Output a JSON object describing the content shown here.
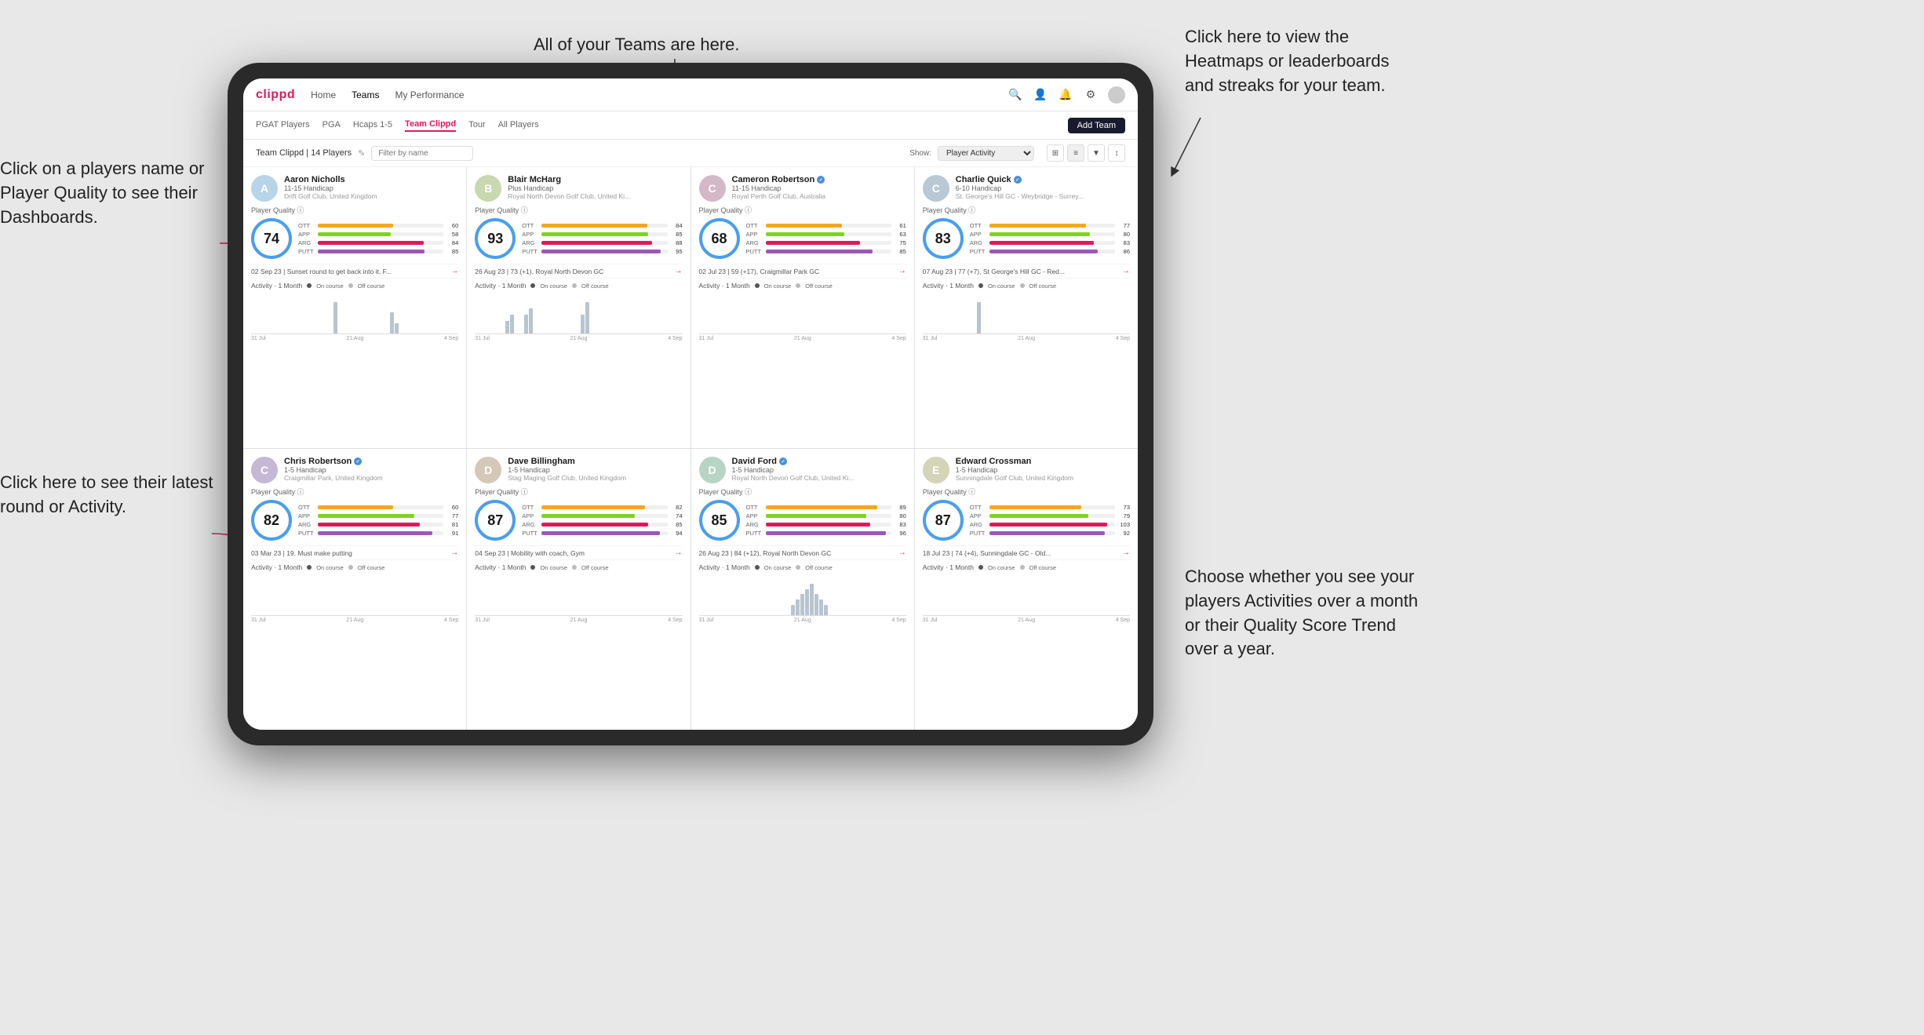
{
  "annotations": {
    "left_top": "Click on a players name\nor Player Quality to see\ntheir Dashboards.",
    "left_bottom": "Click here to see their latest\nround or Activity.",
    "top_center": "All of your Teams are here.",
    "top_right": "Click here to view the\nHeatmaps or leaderboards\nand streaks for your team.",
    "bottom_right": "Choose whether you see\nyour players Activities over\na month or their Quality\nScore Trend over a year."
  },
  "navbar": {
    "logo": "clippd",
    "links": [
      "Home",
      "Teams",
      "My Performance"
    ],
    "active_link": "Teams"
  },
  "subnav": {
    "links": [
      "PGAT Players",
      "PGA",
      "Hcaps 1-5",
      "Team Clippd",
      "Tour",
      "All Players"
    ],
    "active_link": "Team Clippd",
    "add_team_label": "Add Team"
  },
  "team_header": {
    "title": "Team Clippd | 14 Players",
    "filter_placeholder": "Filter by name",
    "show_label": "Show:",
    "show_value": "Player Activity"
  },
  "players": [
    {
      "name": "Aaron Nicholls",
      "handicap": "11-15 Handicap",
      "club": "Drift Golf Club, United Kingdom",
      "verified": false,
      "pq": 74,
      "bars": [
        {
          "label": "OTT",
          "value": 60,
          "color": "#f5a623",
          "max": 100
        },
        {
          "label": "APP",
          "value": 58,
          "color": "#7ed321",
          "max": 100
        },
        {
          "label": "ARG",
          "value": 84,
          "color": "#e0195a",
          "max": 100
        },
        {
          "label": "PUTT",
          "value": 85,
          "color": "#9b59b6",
          "max": 100
        }
      ],
      "latest_round": "02 Sep 23 | Sunset round to get back into it, F...",
      "activity_bars": [
        0,
        0,
        0,
        0,
        0,
        0,
        0,
        0,
        0,
        0,
        0,
        0,
        0,
        0,
        0,
        3,
        0,
        0,
        0,
        0,
        0,
        0,
        0,
        0,
        0,
        0,
        0,
        2,
        1
      ],
      "dates": [
        "31 Jul",
        "21 Aug",
        "4 Sep"
      ]
    },
    {
      "name": "Blair McHarg",
      "handicap": "Plus Handicap",
      "club": "Royal North Devon Golf Club, United Ki...",
      "verified": false,
      "pq": 93,
      "bars": [
        {
          "label": "OTT",
          "value": 84,
          "color": "#f5a623",
          "max": 100
        },
        {
          "label": "APP",
          "value": 85,
          "color": "#7ed321",
          "max": 100
        },
        {
          "label": "ARG",
          "value": 88,
          "color": "#e0195a",
          "max": 100
        },
        {
          "label": "PUTT",
          "value": 95,
          "color": "#9b59b6",
          "max": 100
        }
      ],
      "latest_round": "26 Aug 23 | 73 (+1), Royal North Devon GC",
      "activity_bars": [
        0,
        0,
        0,
        0,
        2,
        3,
        0,
        0,
        3,
        4,
        0,
        0,
        0,
        0,
        0,
        0,
        0,
        0,
        0,
        0,
        3,
        5,
        0,
        0,
        0,
        0,
        0,
        0,
        0
      ],
      "dates": [
        "31 Jul",
        "21 Aug",
        "4 Sep"
      ]
    },
    {
      "name": "Cameron Robertson",
      "handicap": "11-15 Handicap",
      "club": "Royal Perth Golf Club, Australia",
      "verified": true,
      "pq": 68,
      "bars": [
        {
          "label": "OTT",
          "value": 61,
          "color": "#f5a623",
          "max": 100
        },
        {
          "label": "APP",
          "value": 63,
          "color": "#7ed321",
          "max": 100
        },
        {
          "label": "ARG",
          "value": 75,
          "color": "#e0195a",
          "max": 100
        },
        {
          "label": "PUTT",
          "value": 85,
          "color": "#9b59b6",
          "max": 100
        }
      ],
      "latest_round": "02 Jul 23 | 59 (+17), Craigmillar Park GC",
      "activity_bars": [
        0,
        0,
        0,
        0,
        0,
        0,
        0,
        0,
        0,
        0,
        0,
        0,
        0,
        0,
        0,
        0,
        0,
        0,
        0,
        0,
        0,
        0,
        0,
        0,
        0,
        0,
        0,
        0,
        0
      ],
      "dates": [
        "31 Jul",
        "21 Aug",
        "4 Sep"
      ]
    },
    {
      "name": "Charlie Quick",
      "handicap": "6-10 Handicap",
      "club": "St. George's Hill GC - Weybridge - Surrey...",
      "verified": true,
      "pq": 83,
      "bars": [
        {
          "label": "OTT",
          "value": 77,
          "color": "#f5a623",
          "max": 100
        },
        {
          "label": "APP",
          "value": 80,
          "color": "#7ed321",
          "max": 100
        },
        {
          "label": "ARG",
          "value": 83,
          "color": "#e0195a",
          "max": 100
        },
        {
          "label": "PUTT",
          "value": 86,
          "color": "#9b59b6",
          "max": 100
        }
      ],
      "latest_round": "07 Aug 23 | 77 (+7), St George's Hill GC - Red...",
      "activity_bars": [
        0,
        0,
        0,
        0,
        0,
        0,
        0,
        0,
        0,
        2,
        0,
        0,
        0,
        0,
        0,
        0,
        0,
        0,
        0,
        0,
        0,
        0,
        0,
        0,
        0,
        0,
        0,
        0,
        0
      ],
      "dates": [
        "31 Jul",
        "21 Aug",
        "4 Sep"
      ]
    },
    {
      "name": "Chris Robertson",
      "handicap": "1-5 Handicap",
      "club": "Craigmillar Park, United Kingdom",
      "verified": true,
      "pq": 82,
      "bars": [
        {
          "label": "OTT",
          "value": 60,
          "color": "#f5a623",
          "max": 100
        },
        {
          "label": "APP",
          "value": 77,
          "color": "#7ed321",
          "max": 100
        },
        {
          "label": "ARG",
          "value": 81,
          "color": "#e0195a",
          "max": 100
        },
        {
          "label": "PUTT",
          "value": 91,
          "color": "#9b59b6",
          "max": 100
        }
      ],
      "latest_round": "03 Mar 23 | 19, Must make putting",
      "activity_bars": [
        0,
        0,
        0,
        0,
        0,
        0,
        0,
        0,
        0,
        0,
        0,
        0,
        0,
        0,
        0,
        0,
        0,
        0,
        0,
        0,
        0,
        0,
        0,
        0,
        0,
        0,
        0,
        0,
        0
      ],
      "dates": [
        "31 Jul",
        "21 Aug",
        "4 Sep"
      ]
    },
    {
      "name": "Dave Billingham",
      "handicap": "1-5 Handicap",
      "club": "Stag Maging Golf Club, United Kingdom",
      "verified": false,
      "pq": 87,
      "bars": [
        {
          "label": "OTT",
          "value": 82,
          "color": "#f5a623",
          "max": 100
        },
        {
          "label": "APP",
          "value": 74,
          "color": "#7ed321",
          "max": 100
        },
        {
          "label": "ARG",
          "value": 85,
          "color": "#e0195a",
          "max": 100
        },
        {
          "label": "PUTT",
          "value": 94,
          "color": "#9b59b6",
          "max": 100
        }
      ],
      "latest_round": "04 Sep 23 | Mobility with coach, Gym",
      "activity_bars": [
        0,
        0,
        0,
        0,
        0,
        0,
        0,
        0,
        0,
        0,
        0,
        0,
        0,
        0,
        0,
        0,
        0,
        0,
        0,
        0,
        0,
        0,
        0,
        0,
        0,
        0,
        0,
        0,
        0
      ],
      "dates": [
        "31 Jul",
        "21 Aug",
        "4 Sep"
      ]
    },
    {
      "name": "David Ford",
      "handicap": "1-5 Handicap",
      "club": "Royal North Devon Golf Club, United Ki...",
      "verified": true,
      "pq": 85,
      "bars": [
        {
          "label": "OTT",
          "value": 89,
          "color": "#f5a623",
          "max": 100
        },
        {
          "label": "APP",
          "value": 80,
          "color": "#7ed321",
          "max": 100
        },
        {
          "label": "ARG",
          "value": 83,
          "color": "#e0195a",
          "max": 100
        },
        {
          "label": "PUTT",
          "value": 96,
          "color": "#9b59b6",
          "max": 100
        }
      ],
      "latest_round": "26 Aug 23 | 84 (+12), Royal North Devon GC",
      "activity_bars": [
        0,
        0,
        0,
        0,
        0,
        0,
        0,
        0,
        0,
        0,
        0,
        0,
        0,
        0,
        0,
        0,
        0,
        2,
        3,
        4,
        5,
        6,
        4,
        3,
        2,
        0,
        0,
        0,
        0
      ],
      "dates": [
        "31 Jul",
        "21 Aug",
        "4 Sep"
      ]
    },
    {
      "name": "Edward Crossman",
      "handicap": "1-5 Handicap",
      "club": "Sunningdale Golf Club, United Kingdom",
      "verified": false,
      "pq": 87,
      "bars": [
        {
          "label": "OTT",
          "value": 73,
          "color": "#f5a623",
          "max": 100
        },
        {
          "label": "APP",
          "value": 79,
          "color": "#7ed321",
          "max": 100
        },
        {
          "label": "ARG",
          "value": 103,
          "color": "#e0195a",
          "max": 110
        },
        {
          "label": "PUTT",
          "value": 92,
          "color": "#9b59b6",
          "max": 100
        }
      ],
      "latest_round": "18 Jul 23 | 74 (+4), Sunningdale GC - Old...",
      "activity_bars": [
        0,
        0,
        0,
        0,
        0,
        0,
        0,
        0,
        0,
        0,
        0,
        0,
        0,
        0,
        0,
        0,
        0,
        0,
        0,
        0,
        0,
        0,
        0,
        0,
        0,
        0,
        0,
        0,
        0
      ],
      "dates": [
        "31 Jul",
        "21 Aug",
        "4 Sep"
      ]
    }
  ]
}
